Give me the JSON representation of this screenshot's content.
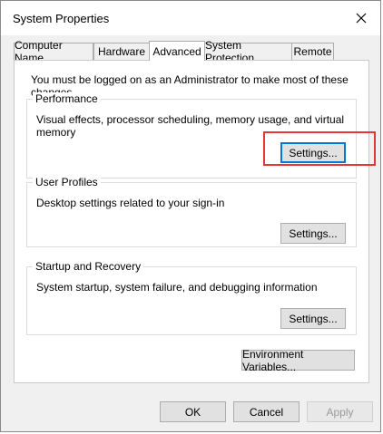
{
  "window": {
    "title": "System Properties"
  },
  "tabs": [
    {
      "label": "Computer Name",
      "active": false
    },
    {
      "label": "Hardware",
      "active": false
    },
    {
      "label": "Advanced",
      "active": true
    },
    {
      "label": "System Protection",
      "active": false
    },
    {
      "label": "Remote",
      "active": false
    }
  ],
  "notice": "You must be logged on as an Administrator to make most of these changes.",
  "performance": {
    "title": "Performance",
    "description": "Visual effects, processor scheduling, memory usage, and virtual memory",
    "button": "Settings..."
  },
  "user_profiles": {
    "title": "User Profiles",
    "description": "Desktop settings related to your sign-in",
    "button": "Settings..."
  },
  "startup_recovery": {
    "title": "Startup and Recovery",
    "description": "System startup, system failure, and debugging information",
    "button": "Settings..."
  },
  "env_vars_button": "Environment Variables...",
  "footer": {
    "ok": "OK",
    "cancel": "Cancel",
    "apply": "Apply"
  },
  "colors": {
    "highlight": "#e53535",
    "focus": "#0078d7"
  },
  "icons": {
    "close": "close-icon"
  }
}
